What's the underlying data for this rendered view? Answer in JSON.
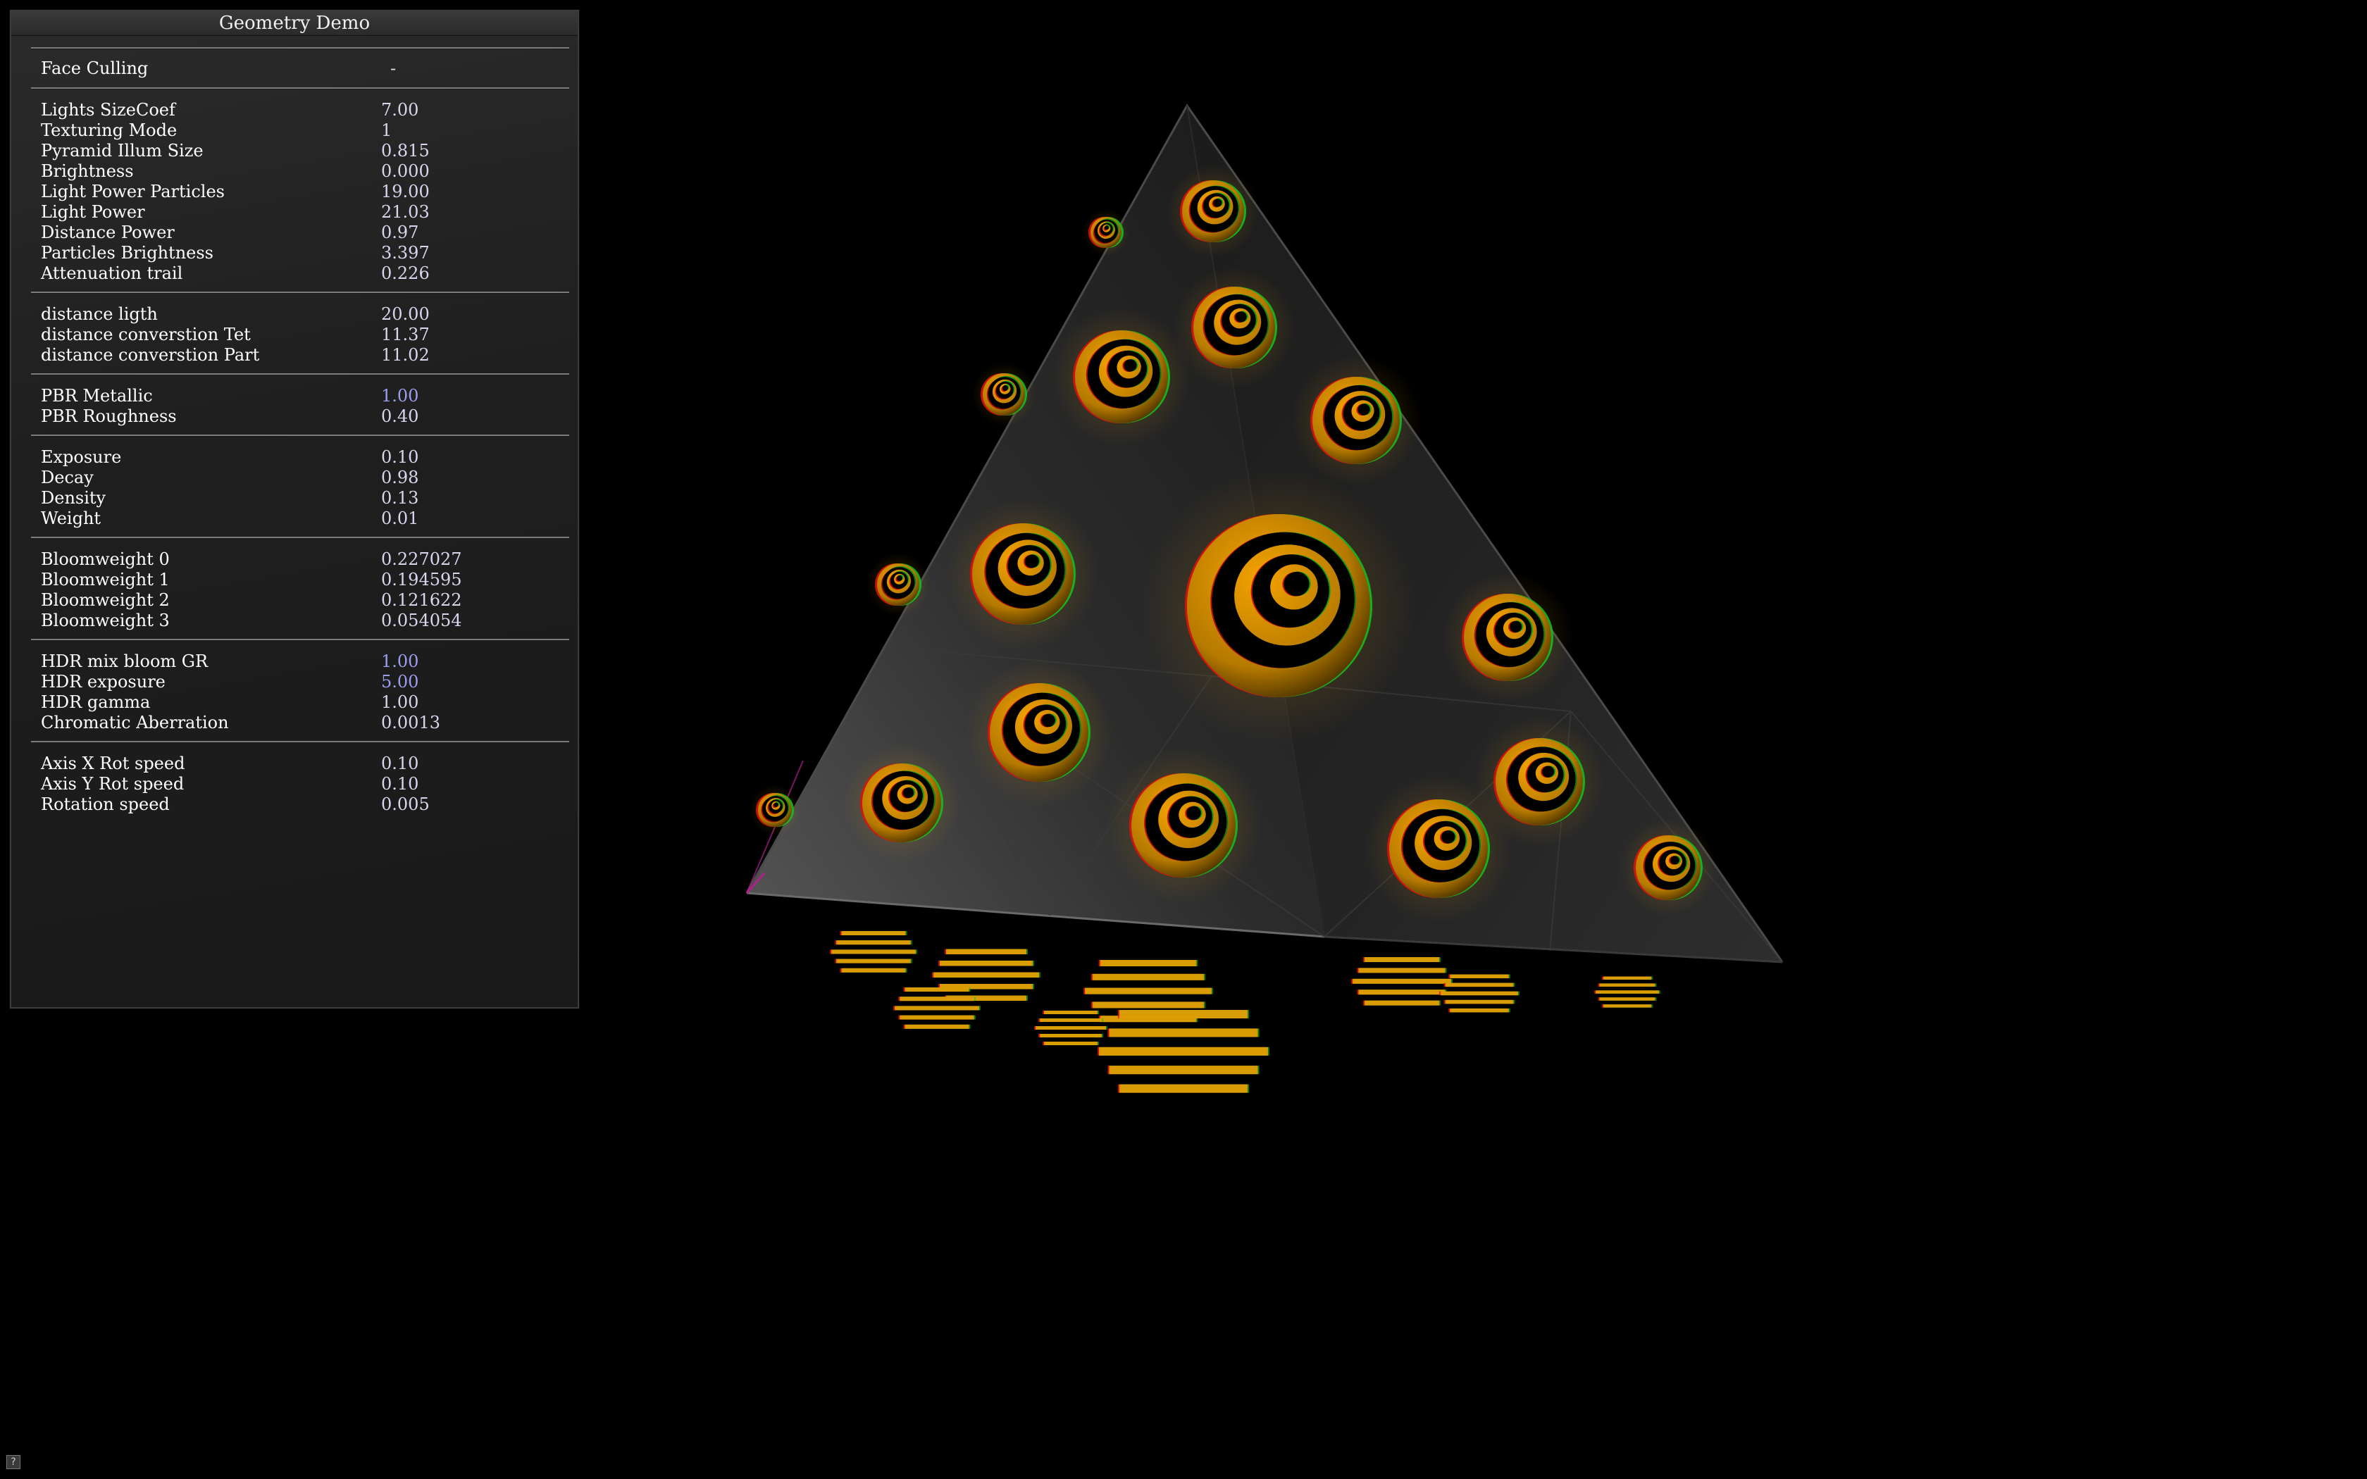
{
  "panel": {
    "title": "Geometry Demo",
    "face_culling": {
      "label": "Face Culling",
      "value": "-"
    },
    "groups": [
      [
        {
          "label": "Lights SizeCoef",
          "value": "7.00"
        },
        {
          "label": "Texturing Mode",
          "value": "1"
        },
        {
          "label": "Pyramid Illum Size",
          "value": "0.815"
        },
        {
          "label": "Brightness",
          "value": "0.000"
        },
        {
          "label": "Light Power Particles",
          "value": "19.00"
        },
        {
          "label": "Light Power",
          "value": "21.03"
        },
        {
          "label": "Distance Power",
          "value": "0.97"
        },
        {
          "label": "Particles Brightness",
          "value": "3.397"
        },
        {
          "label": "Attenuation trail",
          "value": "0.226"
        }
      ],
      [
        {
          "label": "distance ligth",
          "value": "20.00"
        },
        {
          "label": "distance converstion Tet",
          "value": "11.37"
        },
        {
          "label": "distance converstion Part",
          "value": "11.02"
        }
      ],
      [
        {
          "label": "PBR Metallic",
          "value": "1.00",
          "highlight": true
        },
        {
          "label": "PBR Roughness",
          "value": "0.40"
        }
      ],
      [
        {
          "label": "Exposure",
          "value": "0.10"
        },
        {
          "label": "Decay",
          "value": "0.98"
        },
        {
          "label": "Density",
          "value": "0.13"
        },
        {
          "label": "Weight",
          "value": "0.01"
        }
      ],
      [
        {
          "label": "Bloomweight 0",
          "value": "0.227027"
        },
        {
          "label": "Bloomweight 1",
          "value": "0.194595"
        },
        {
          "label": "Bloomweight 2",
          "value": "0.121622"
        },
        {
          "label": "Bloomweight 3",
          "value": "0.054054"
        }
      ],
      [
        {
          "label": "HDR mix bloom GR",
          "value": "1.00",
          "highlight": true
        },
        {
          "label": "HDR exposure",
          "value": "5.00",
          "highlight": true
        },
        {
          "label": "HDR gamma",
          "value": "1.00"
        },
        {
          "label": "Chromatic Aberration",
          "value": "0.0013"
        }
      ],
      [
        {
          "label": "Axis X Rot speed",
          "value": "0.10"
        },
        {
          "label": "Axis Y Rot speed",
          "value": "0.10"
        },
        {
          "label": "Rotation speed",
          "value": "0.005"
        }
      ]
    ]
  },
  "help_button": {
    "label": "?"
  },
  "scene": {
    "icon": "pyramid-scene",
    "accent": "#f2a200",
    "ring_red": "#e01010",
    "ring_green": "#10c020"
  }
}
